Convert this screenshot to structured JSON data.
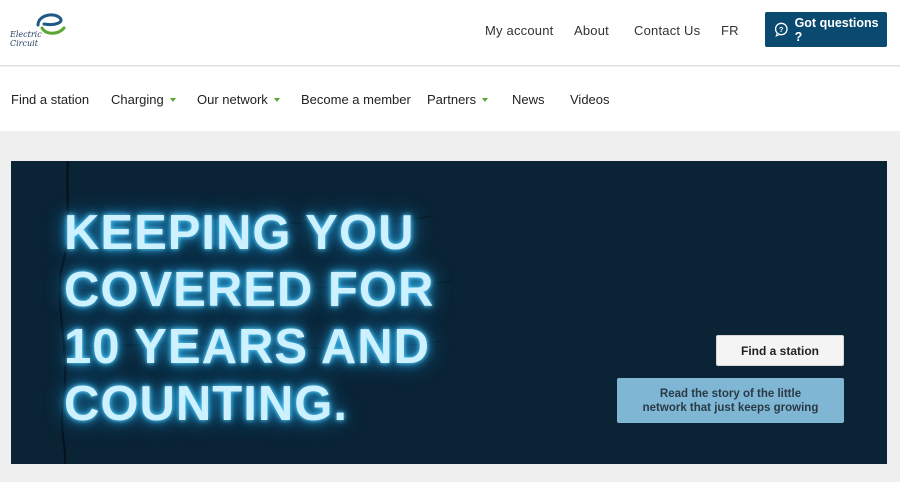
{
  "brand": {
    "logo_text_line1": "Electric",
    "logo_text_line2": "Circuit",
    "accent_green": "#5aa832",
    "accent_blue": "#0b4a70"
  },
  "header": {
    "links": [
      "My account",
      "About",
      "Contact Us",
      "FR"
    ],
    "cta_label": "Got questions ?",
    "cta_icon": "question-bubble-icon"
  },
  "nav": {
    "items": [
      {
        "label": "Find a station",
        "has_dropdown": false
      },
      {
        "label": "Charging",
        "has_dropdown": true
      },
      {
        "label": "Our network",
        "has_dropdown": true
      },
      {
        "label": "Become a member",
        "has_dropdown": false
      },
      {
        "label": "Partners",
        "has_dropdown": true
      },
      {
        "label": "News",
        "has_dropdown": false
      },
      {
        "label": "Videos",
        "has_dropdown": false
      }
    ]
  },
  "hero": {
    "headline_lines": [
      "KEEPING YOU",
      "COVERED FOR",
      "10 YEARS AND",
      "COUNTING."
    ],
    "find_button": "Find a station",
    "story_button_line1": "Read the story of the little",
    "story_button_line2": "network that just keeps growing"
  }
}
